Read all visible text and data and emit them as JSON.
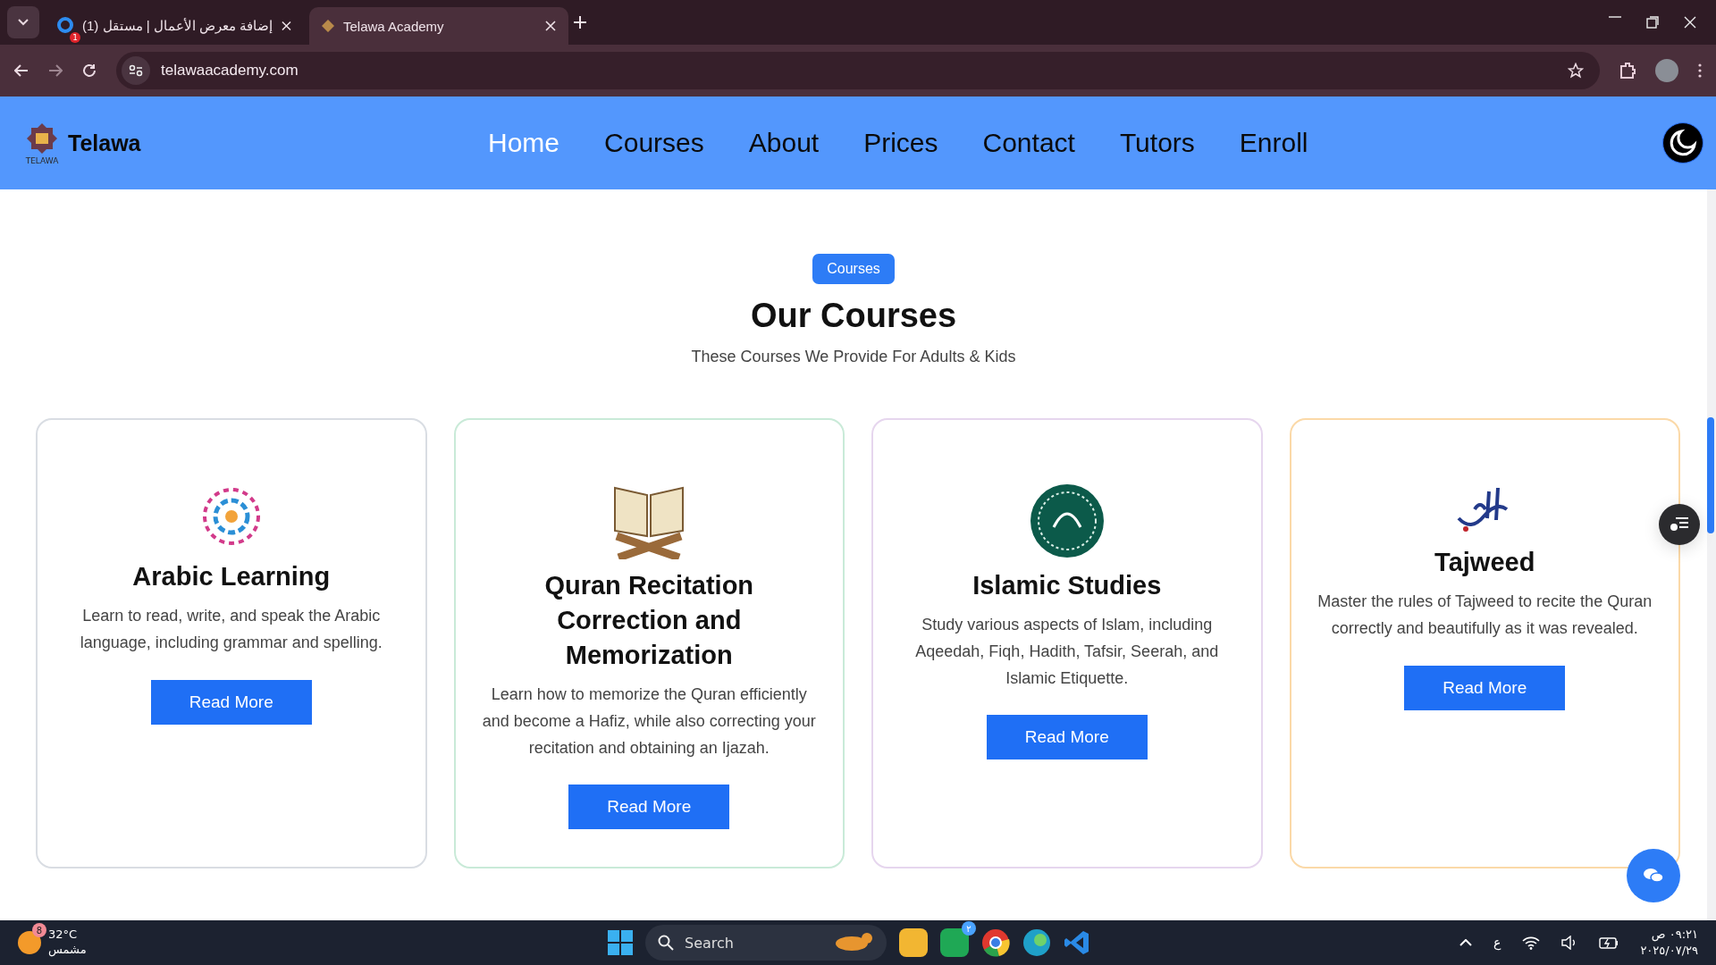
{
  "browser": {
    "tabs": [
      {
        "title": "(1) إضافة معرض الأعمال | مستقل",
        "badge": "1",
        "selected": false
      },
      {
        "title": "Telawa Academy",
        "selected": true
      }
    ],
    "url": "telawaacademy.com"
  },
  "header": {
    "logo_caption": "TELAWA",
    "brand": "Telawa",
    "nav": [
      {
        "label": "Home",
        "selected": true
      },
      {
        "label": "Courses",
        "selected": false
      },
      {
        "label": "About",
        "selected": false
      },
      {
        "label": "Prices",
        "selected": false
      },
      {
        "label": "Contact",
        "selected": false
      },
      {
        "label": "Tutors",
        "selected": false
      },
      {
        "label": "Enroll",
        "selected": false
      }
    ]
  },
  "section": {
    "badge": "Courses",
    "title": "Our Courses",
    "subtitle": "These Courses We Provide For Adults & Kids"
  },
  "courses": [
    {
      "kind": "calligraphy",
      "title": "Arabic Learning",
      "description": "Learn to read, write, and speak the Arabic language, including grammar and spelling.",
      "button": "Read More",
      "color": "#d9dde3"
    },
    {
      "kind": "book",
      "title": "Quran Recitation Correction and Memorization",
      "description": "Learn how to memorize the Quran efficiently and become a Hafiz, while also correcting your recitation and obtaining an Ijazah.",
      "button": "Read More",
      "color": "#c9ead8"
    },
    {
      "kind": "emblem",
      "title": "Islamic Studies",
      "description": "Study various aspects of Islam, including Aqeedah, Fiqh, Hadith, Tafsir, Seerah, and Islamic Etiquette.",
      "button": "Read More",
      "color": "#e6d6ee"
    },
    {
      "kind": "script",
      "title": "Tajweed",
      "description": "Master the rules of Tajweed to recite the Quran correctly and beautifully as it was revealed.",
      "button": "Read More",
      "color": "#fbd9a8"
    }
  ],
  "taskbar": {
    "weather": {
      "temp": "32°C",
      "condition": "مشمس",
      "badge": "8"
    },
    "search": "Search",
    "whatsapp_badge": "٢",
    "language": "ع",
    "time": "٠٩:٢١ ص",
    "date": "٢٠٢٥/٠٧/٢٩"
  }
}
